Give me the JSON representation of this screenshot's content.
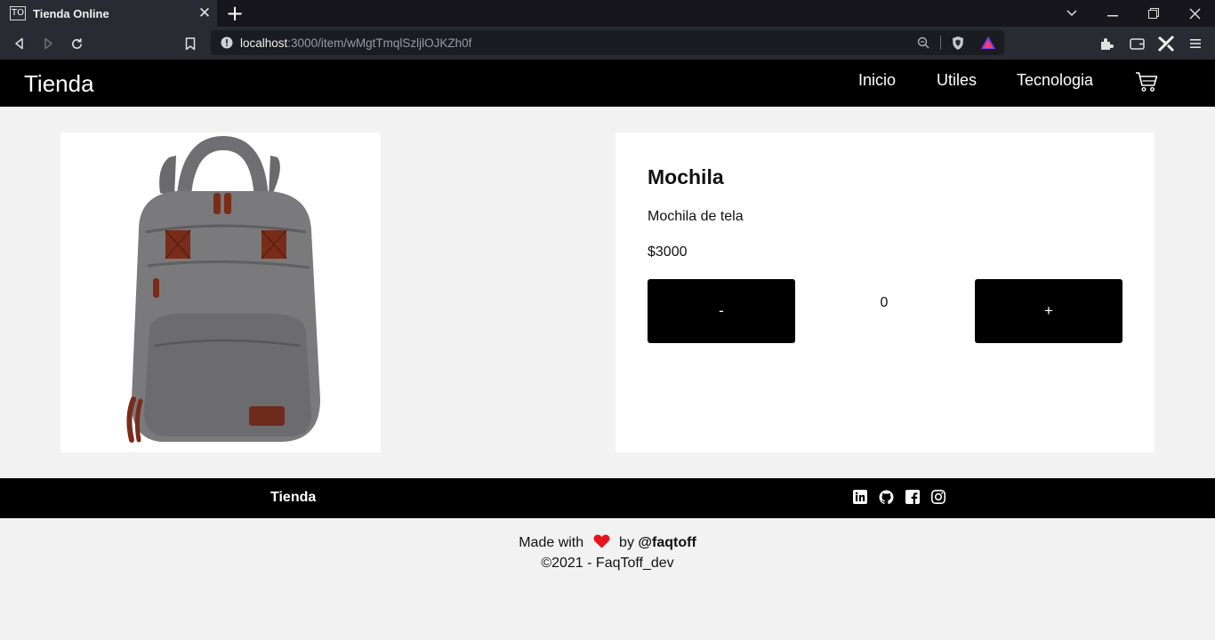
{
  "browser": {
    "tab_title": "Tienda Online",
    "tab_favicon_text": "TO",
    "url_host": "localhost",
    "url_path": ":3000/item/wMgtTmqlSzljlOJKZh0f"
  },
  "header": {
    "brand": "Tienda",
    "nav": [
      "Inicio",
      "Utiles",
      "Tecnologia"
    ],
    "cart_icon": "cart-icon"
  },
  "product": {
    "name": "Mochila",
    "description": "Mochila de tela",
    "price": "$3000",
    "decrement_label": "-",
    "increment_label": "+",
    "quantity": "0"
  },
  "footer": {
    "brand": "Tienda",
    "social_icons": [
      "linkedin-icon",
      "github-icon",
      "facebook-icon",
      "instagram-icon"
    ],
    "made_with": "Made with",
    "by": "by",
    "author": "@faqtoff",
    "copyright": "©2021 - FaqToff_dev"
  },
  "colors": {
    "header_bg": "#000000",
    "page_bg": "#f2f2f2",
    "heart": "#e8141b"
  }
}
